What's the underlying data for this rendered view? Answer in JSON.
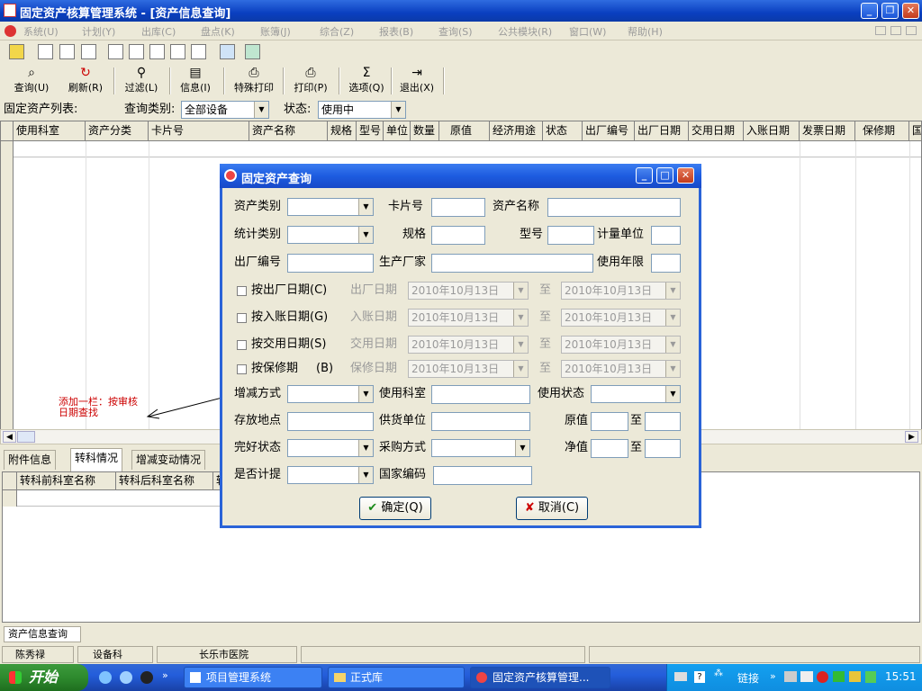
{
  "window": {
    "title": "固定资产核算管理系统 - [资产信息查询]"
  },
  "menus": [
    "系统(U)",
    "计划(Y)",
    "出库(C)",
    "盘点(K)",
    "账簿(J)",
    "综合(Z)",
    "报表(B)",
    "查询(S)",
    "公共模块(R)",
    "窗口(W)",
    "帮助(H)"
  ],
  "toolbar": {
    "query": "查询(U)",
    "refresh": "刷新(R)",
    "filter": "过滤(L)",
    "info": "信息(I)",
    "special_print": "特殊打印",
    "print": "打印(P)",
    "options": "选项(Q)",
    "exit": "退出(X)"
  },
  "filter": {
    "list_label": "固定资产列表:",
    "category_label": "查询类别:",
    "category_value": "全部设备",
    "status_label": "状态:",
    "status_value": "使用中"
  },
  "grid": {
    "columns": [
      "使用科室",
      "资产分类",
      "卡片号",
      "资产名称",
      "规格",
      "型号",
      "单位",
      "数量",
      "原值",
      "经济用途",
      "状态",
      "出厂编号",
      "出厂日期",
      "交用日期",
      "入账日期",
      "发票日期",
      "保修期",
      "国"
    ]
  },
  "annotation": {
    "line1": "添加一栏：按审核",
    "line2": "日期查找"
  },
  "tabs": [
    "附件信息",
    "转科情况",
    "增减变动情况"
  ],
  "lower_grid": {
    "columns": [
      "转科前科室名称",
      "转科后科室名称",
      "转"
    ]
  },
  "panel_tab": "资产信息查询",
  "status": {
    "user": "陈秀禄",
    "dept": "设备科",
    "org": "长乐市医院"
  },
  "taskbar": {
    "start": "开始",
    "tasks": [
      "项目管理系统",
      "正式库",
      "固定资产核算管理..."
    ],
    "links": "链接",
    "clock": "15:51"
  },
  "dialog": {
    "title": "固定资产查询",
    "asset_category": "资产类别",
    "card_no": "卡片号",
    "asset_name": "资产名称",
    "stat_category": "统计类别",
    "spec": "规格",
    "model": "型号",
    "unit": "计量单位",
    "factory_no": "出厂编号",
    "manufacturer": "生产厂家",
    "life": "使用年限",
    "by_factory_date": "按出厂日期(C)",
    "by_entry_date": "按入账日期(G)",
    "by_use_date": "按交用日期(S)",
    "by_warranty": "按保修期",
    "warranty_key": "(B)",
    "factory_date": "出厂日期",
    "entry_date": "入账日期",
    "use_date": "交用日期",
    "warranty_date": "保修日期",
    "to": "至",
    "date_value": "2010年10月13日",
    "change_method": "增减方式",
    "use_dept": "使用科室",
    "use_status": "使用状态",
    "location": "存放地点",
    "supplier": "供货单位",
    "original_value": "原值",
    "condition": "完好状态",
    "purchase_method": "采购方式",
    "net_value": "净值",
    "depreciation": "是否计提",
    "national_code": "国家编码",
    "ok": "确定(Q)",
    "cancel": "取消(C)"
  }
}
